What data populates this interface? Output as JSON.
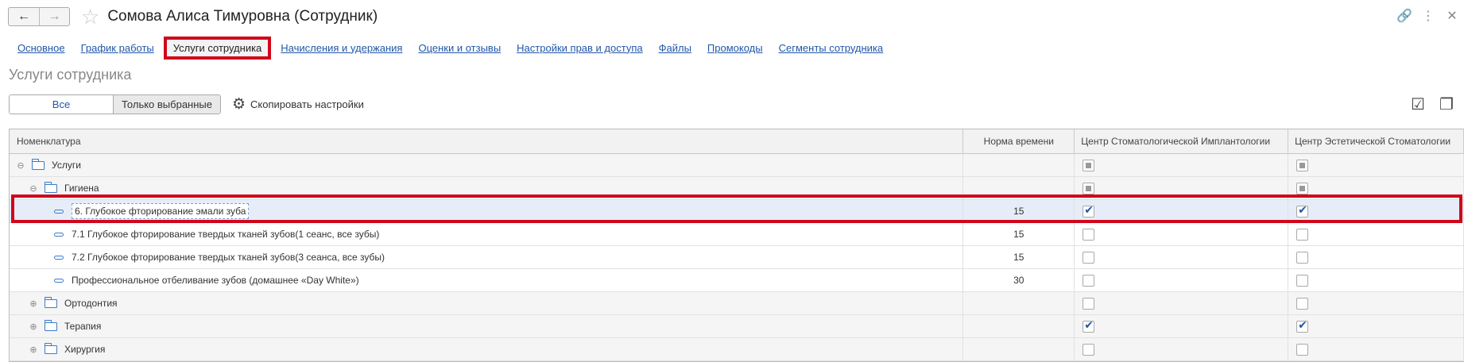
{
  "window": {
    "back_icon": "←",
    "forward_icon": "→",
    "star_icon": "☆",
    "title": "Сомова Алиса Тимуровна (Сотрудник)",
    "link_icon": "🔗",
    "more_icon": "⋮",
    "close_icon": "✕"
  },
  "tabs": [
    {
      "label": "Основное"
    },
    {
      "label": "График работы"
    },
    {
      "label": "Услуги сотрудника"
    },
    {
      "label": "Начисления и удержания"
    },
    {
      "label": "Оценки и отзывы"
    },
    {
      "label": "Настройки прав и доступа"
    },
    {
      "label": "Файлы"
    },
    {
      "label": "Промокоды"
    },
    {
      "label": "Сегменты сотрудника"
    }
  ],
  "section_title": "Услуги сотрудника",
  "toolbar": {
    "all_label": "Все",
    "selected_label": "Только выбранные",
    "copy_label": "Скопировать настройки",
    "gear_icon": "⚙",
    "check_all_icon": "☑",
    "uncheck_all_icon": "❐"
  },
  "table": {
    "headers": {
      "name": "Номенклатура",
      "norm": "Норма времени",
      "col1": "Центр Стоматологической Имплантологии",
      "col2": "Центр Эстетической Стоматологии"
    },
    "expand_icon": "⊖",
    "collapse_icon": "⊕",
    "rows": [
      {
        "name": "Услуги",
        "norm": "",
        "c1": "partial",
        "c2": "partial"
      },
      {
        "name": "Гигиена",
        "norm": "",
        "c1": "partial",
        "c2": "partial"
      },
      {
        "name": "6. Глубокое фторирование эмали зуба",
        "norm": "15",
        "c1": "checked",
        "c2": "checked"
      },
      {
        "name": "7.1 Глубокое фторирование твердых тканей зубов(1 сеанс, все зубы)",
        "norm": "15",
        "c1": "unchecked",
        "c2": "unchecked"
      },
      {
        "name": "7.2 Глубокое фторирование твердых тканей зубов(3 сеанса, все зубы)",
        "norm": "15",
        "c1": "unchecked",
        "c2": "unchecked"
      },
      {
        "name": "Профессиональное отбеливание  зубов (домашнее «Day White»)",
        "norm": "30",
        "c1": "unchecked",
        "c2": "unchecked"
      },
      {
        "name": "Ортодонтия",
        "norm": "",
        "c1": "unchecked",
        "c2": "unchecked"
      },
      {
        "name": "Терапия",
        "norm": "",
        "c1": "checked",
        "c2": "checked"
      },
      {
        "name": "Хирургия",
        "norm": "",
        "c1": "unchecked",
        "c2": "unchecked"
      }
    ]
  },
  "colors": {
    "accent": "#2257a8",
    "highlight": "#d0071b"
  }
}
